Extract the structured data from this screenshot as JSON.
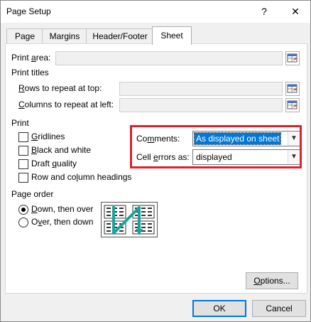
{
  "window": {
    "title": "Page Setup",
    "help_glyph": "?",
    "close_glyph": "✕"
  },
  "tabs": [
    {
      "label": "Page"
    },
    {
      "label": "Margins"
    },
    {
      "label": "Header/Footer"
    },
    {
      "label": "Sheet"
    }
  ],
  "print_area": {
    "label_pre": "Print ",
    "label_ul": "a",
    "label_post": "rea:",
    "value": ""
  },
  "print_titles": {
    "heading": "Print titles",
    "rows": {
      "label_ul": "R",
      "label_post": "ows to repeat at top:",
      "value": ""
    },
    "columns": {
      "label_ul": "C",
      "label_post": "olumns to repeat at left:",
      "value": ""
    }
  },
  "print": {
    "heading": "Print",
    "checkboxes": [
      {
        "ul": "G",
        "rest": "ridlines",
        "checked": false
      },
      {
        "ul": "B",
        "rest": "lack and white",
        "checked": false
      },
      {
        "pre": "Draft ",
        "ul": "q",
        "rest": "uality",
        "checked": false
      },
      {
        "pre": "Row and co",
        "ul": "l",
        "rest": "umn headings",
        "checked": false
      }
    ],
    "comments": {
      "pre": "Co",
      "ul": "m",
      "rest": "ments:",
      "value": "As displayed on sheet"
    },
    "cell_errors": {
      "pre": "Cell ",
      "ul": "e",
      "rest": "rrors as:",
      "value": "displayed"
    }
  },
  "page_order": {
    "heading": "Page order",
    "options": [
      {
        "ul": "D",
        "rest": "own, then over",
        "selected": true
      },
      {
        "pre": "O",
        "ul": "v",
        "rest": "er, then down",
        "selected": false
      }
    ]
  },
  "buttons": {
    "options": {
      "ul": "O",
      "rest": "ptions..."
    },
    "ok": "OK",
    "cancel": "Cancel"
  },
  "colors": {
    "highlight": "#0078d7",
    "annotation_red": "#e0202a",
    "arrow_teal": "#1aa39a"
  }
}
